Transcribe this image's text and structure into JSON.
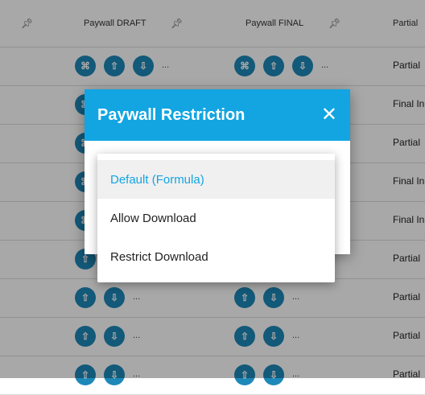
{
  "header": {
    "col_draft": "Paywall DRAFT",
    "col_final": "Paywall FINAL",
    "col_status": "Partial"
  },
  "icons": {
    "pin": "pin-icon",
    "attach": "paperclip-icon",
    "upload": "upload-icon",
    "download": "download-icon"
  },
  "rows": [
    {
      "status": "Partial",
      "dots": "..."
    },
    {
      "status": "Final In",
      "dots": "..."
    },
    {
      "status": "Partial",
      "dots": "..."
    },
    {
      "status": "Final In",
      "dots": "..."
    },
    {
      "status": "Final In",
      "dots": "..."
    },
    {
      "status": "Partial",
      "dots": "..."
    },
    {
      "status": "Partial",
      "dots": "..."
    },
    {
      "status": "Partial",
      "dots": "..."
    },
    {
      "status": "Partial",
      "dots": "..."
    }
  ],
  "dialog": {
    "title": "Paywall Restriction",
    "close": "✕"
  },
  "menu": {
    "options": [
      "Default (Formula)",
      "Allow Download",
      "Restrict Download"
    ],
    "selected_index": 0
  },
  "colors": {
    "accent": "#12a5e2",
    "button": "#1e88b8"
  }
}
